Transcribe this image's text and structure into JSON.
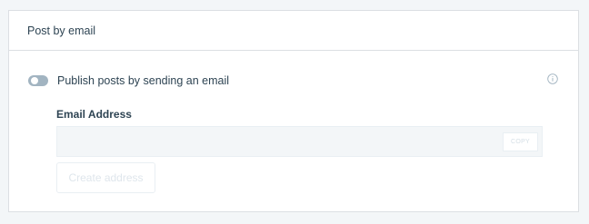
{
  "card": {
    "title": "Post by email"
  },
  "toggle": {
    "label": "Publish posts by sending an email",
    "checked": false
  },
  "email": {
    "label": "Email Address",
    "value": "",
    "copy_label": "COPY"
  },
  "create_button": {
    "label": "Create address"
  },
  "icons": {
    "info": "info-icon"
  },
  "colors": {
    "toggle_off": "#a2b4c1",
    "text_primary": "#2e4453",
    "disabled_text": "#dfe6ec",
    "field_background": "#f3f6f8"
  }
}
